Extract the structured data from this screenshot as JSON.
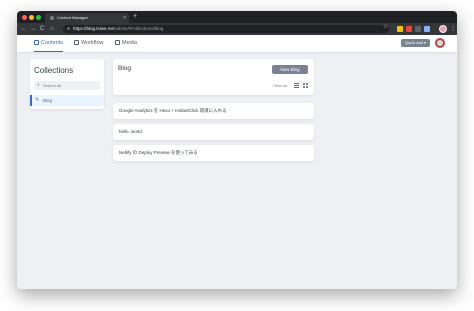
{
  "browser": {
    "tab_title": "Content Manager",
    "tab_close": "×",
    "new_tab": "+",
    "url_host": "https://blog.tsiwe.me",
    "url_path": "/admin/#/collections/blog",
    "back": "←",
    "forward": "→",
    "reload": "C",
    "home": "⌂",
    "star": "☆",
    "menu": "⋮"
  },
  "appbar": {
    "contents_label": "Contents",
    "workflow_label": "Workflow",
    "media_label": "Media",
    "quick_add_label": "Quick add ▾"
  },
  "sidebar": {
    "title": "Collections",
    "search_placeholder": "Search all",
    "items": [
      {
        "label": "Blog"
      }
    ]
  },
  "collection": {
    "title": "Blog",
    "new_button": "New Blog",
    "view_as_label": "View as:"
  },
  "entries": [
    {
      "title": "Google Analytics を Hexo + InstantClick 環境に入れる"
    },
    {
      "title": "hello, world"
    },
    {
      "title": "Netlify の Deploy Preview を使ってみる"
    }
  ],
  "colors": {
    "accent": "#3a69c7",
    "button_gray": "#798291",
    "page_background": "#eff0f4"
  }
}
